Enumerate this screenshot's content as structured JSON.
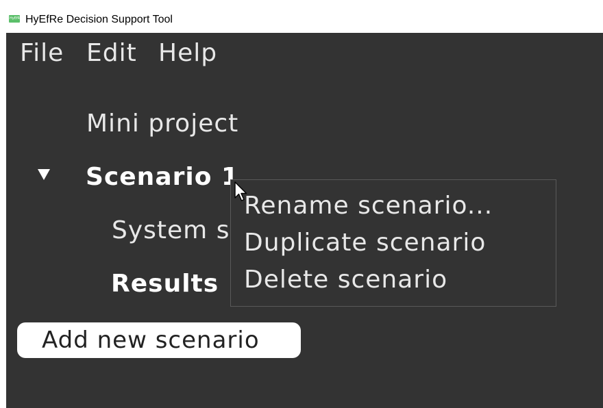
{
  "window": {
    "title": "HyEfRe Decision Support Tool",
    "app_icon_text": "HyEfRe"
  },
  "menubar": {
    "items": [
      "File",
      "Edit",
      "Help"
    ]
  },
  "tree": {
    "project": "Mini project",
    "scenario": "Scenario 1",
    "children": [
      "System s",
      "Results"
    ]
  },
  "context_menu": {
    "items": [
      "Rename scenario...",
      "Duplicate scenario",
      "Delete scenario"
    ]
  },
  "add_button": {
    "label": "Add new scenario"
  },
  "colors": {
    "background": "#333333",
    "text": "#e8e8e8",
    "titlebar": "#ffffff",
    "menu_border": "#5a5a5a",
    "button_bg": "#ffffff"
  },
  "icons": {
    "app": "app-logo-icon",
    "expander": "triangle-down-icon",
    "cursor": "mouse-pointer-icon"
  }
}
